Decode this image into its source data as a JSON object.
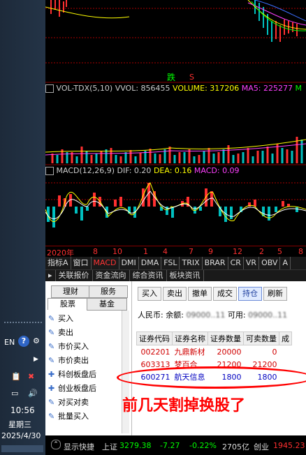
{
  "taskbar": {
    "lang": "EN",
    "time": "10:56",
    "weekday": "星期三",
    "date": "2025/4/30"
  },
  "chart": {
    "label_down": "跌",
    "label_s": "S",
    "vol_title": "VOL-TDX(5,10)",
    "vol_label": "VVOL: 856455",
    "vol_volume": "VOLUME: 317206",
    "vol_ma5": "MA5: 225277",
    "vol_ma10": "M",
    "macd_title": "MACD(12,26,9)",
    "macd_dif": "DIF: 0.20",
    "macd_dea": "DEA: 0.16",
    "macd_macd": "MACD: 0.09",
    "dates": [
      "2020年",
      "8",
      "10",
      "1",
      "4",
      "7",
      "9",
      "12",
      "2",
      "5",
      "8"
    ]
  },
  "indicator_tabs": [
    "指标A",
    "窗口",
    "MACD",
    "DMI",
    "DMA",
    "FSL",
    "TRIX",
    "BRAR",
    "CR",
    "VR",
    "OBV",
    "A"
  ],
  "sub_tabs": [
    "关联报价",
    "资金流向",
    "综合资讯",
    "板块资讯"
  ],
  "trade": {
    "menu_tabs": [
      "理财",
      "服务",
      "股票",
      "基金"
    ],
    "menu_items": [
      "买入",
      "卖出",
      "市价买入",
      "市价卖出",
      "科创板盘后",
      "创业板盘后",
      "对买对卖",
      "批量买入"
    ],
    "buttons": [
      "买入",
      "卖出",
      "撤单",
      "成交",
      "持仓",
      "刷新"
    ],
    "currency_label": "人民币:",
    "balance_label": "余额:",
    "balance_value": "09000..11",
    "available_label": "可用:",
    "available_value": "09000..11",
    "columns": [
      "证券代码",
      "证券名称",
      "证券数量",
      "可卖数量",
      "成"
    ],
    "rows": [
      {
        "code": "002201",
        "name": "九鼎新材",
        "qty": "20000",
        "sellable": "0"
      },
      {
        "code": "603313",
        "name": "梦百合",
        "qty": "21200",
        "sellable": "21200"
      },
      {
        "code": "600271",
        "name": "航天信息",
        "qty": "1800",
        "sellable": "1800"
      }
    ],
    "annotation": "前几天割掉换股了"
  },
  "status": {
    "show_hotkey": "显示快捷",
    "sh_label": "上证",
    "sh_value": "3279.38",
    "sh_change": "-7.27",
    "sh_pct": "-0.22%",
    "sh_amount": "2705亿",
    "cy_label": "创业",
    "cy_value": "1945.23"
  },
  "colors": {
    "up": "#ff3030",
    "down": "#00c0c0",
    "yellow": "#ffff00",
    "magenta": "#ff40ff",
    "green": "#00ff00"
  }
}
